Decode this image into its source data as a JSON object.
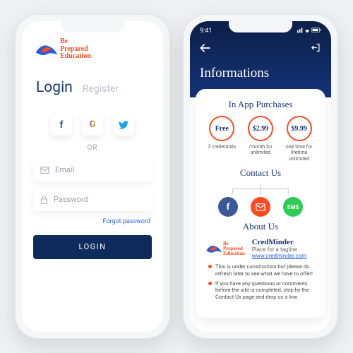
{
  "brand_name": "Be\nPrepared\nEducation",
  "login": {
    "tab_login": "Login",
    "tab_register": "Register",
    "or": "OR",
    "email_ph": "Email",
    "password_ph": "Password",
    "forgot": "Forgot password",
    "button": "LOGIN"
  },
  "info": {
    "status_time": "9:41",
    "title": "Informations",
    "sec_purchases": "In App Purchases",
    "prices": [
      {
        "amount": "Free",
        "sub": "3 credentials"
      },
      {
        "amount": "$2.99",
        "sub": "/month for unlimited"
      },
      {
        "amount": "$9.99",
        "sub": "one time for lifetime unlimited"
      }
    ],
    "sec_contact": "Contact Us",
    "sec_about": "About Us",
    "about_name": "CredMinder",
    "about_tag": "Place for a tagline",
    "about_link": "www.credminder.com",
    "bullets": [
      "This is under construction but please do refresh later to see what we have to offer!",
      "If you have any questions or comments before the site is completed, stop by the Contact Us page and drop us a line."
    ]
  }
}
